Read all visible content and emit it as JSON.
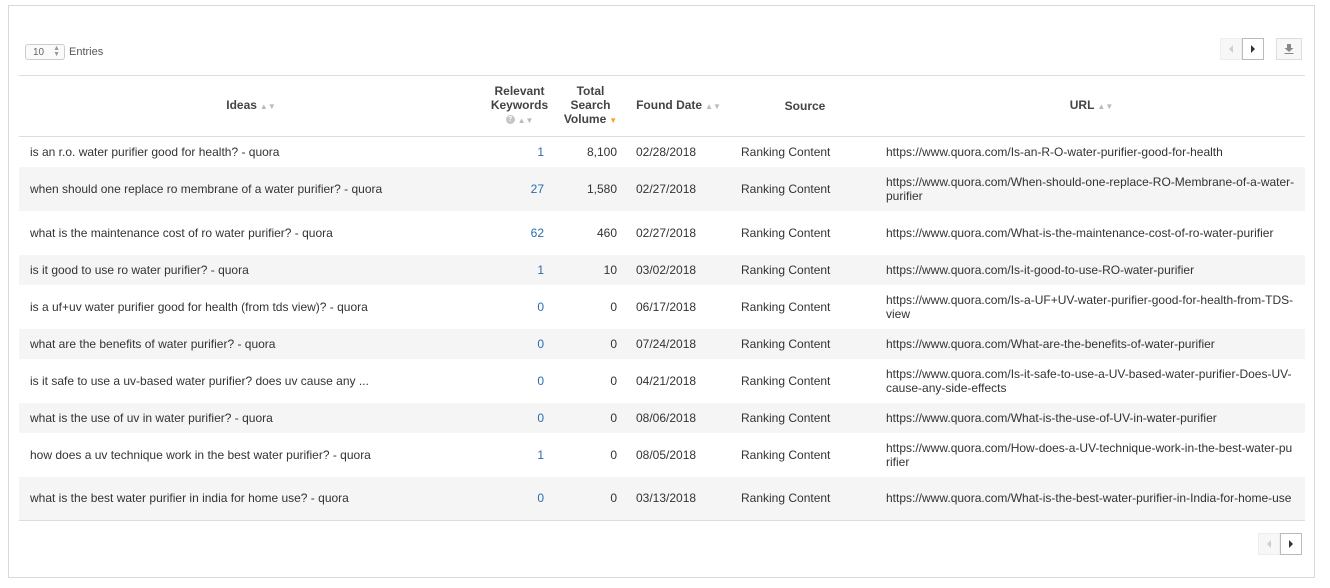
{
  "entries": {
    "value": "10",
    "label": "Entries"
  },
  "columns": {
    "ideas": "Ideas",
    "relevant_keywords": [
      "Relevant",
      "Keywords"
    ],
    "total_search_volume": [
      "Total",
      "Search",
      "Volume"
    ],
    "found_date": "Found Date",
    "source": "Source",
    "url": "URL"
  },
  "sort": {
    "active_column": "Total Search Volume",
    "direction": "descending",
    "color": "#f5a623"
  },
  "link_color": "#2a6bb2",
  "rows": [
    {
      "idea": "is an r.o. water purifier good for health? - quora",
      "keywords": "1",
      "volume": "8,100",
      "date": "02/28/2018",
      "source": "Ranking Content",
      "url": "https://www.quora.com/Is-an-R-O-water-purifier-good-for-health"
    },
    {
      "idea": "when should one replace ro membrane of a water purifier? - quora",
      "keywords": "27",
      "volume": "1,580",
      "date": "02/27/2018",
      "source": "Ranking Content",
      "url": "https://www.quora.com/When-should-one-replace-RO-Membrane-of-a-water-purifier"
    },
    {
      "idea": "what is the maintenance cost of ro water purifier? - quora",
      "keywords": "62",
      "volume": "460",
      "date": "02/27/2018",
      "source": "Ranking Content",
      "url": "https://www.quora.com/What-is-the-maintenance-cost-of-ro-water-purifier"
    },
    {
      "idea": "is it good to use ro water purifier? - quora",
      "keywords": "1",
      "volume": "10",
      "date": "03/02/2018",
      "source": "Ranking Content",
      "url": "https://www.quora.com/Is-it-good-to-use-RO-water-purifier"
    },
    {
      "idea": "is a uf+uv water purifier good for health (from tds view)? - quora",
      "keywords": "0",
      "volume": "0",
      "date": "06/17/2018",
      "source": "Ranking Content",
      "url": "https://www.quora.com/Is-a-UF+UV-water-purifier-good-for-health-from-TDS-view"
    },
    {
      "idea": "what are the benefits of water purifier? - quora",
      "keywords": "0",
      "volume": "0",
      "date": "07/24/2018",
      "source": "Ranking Content",
      "url": "https://www.quora.com/What-are-the-benefits-of-water-purifier"
    },
    {
      "idea": "is it safe to use a uv-based water purifier? does uv cause any ...",
      "keywords": "0",
      "volume": "0",
      "date": "04/21/2018",
      "source": "Ranking Content",
      "url": "https://www.quora.com/Is-it-safe-to-use-a-UV-based-water-purifier-Does-UV-cause-any-side-effects"
    },
    {
      "idea": "what is the use of uv in water purifier? - quora",
      "keywords": "0",
      "volume": "0",
      "date": "08/06/2018",
      "source": "Ranking Content",
      "url": "https://www.quora.com/What-is-the-use-of-UV-in-water-purifier"
    },
    {
      "idea": "how does a uv technique work in the best water purifier? - quora",
      "keywords": "1",
      "volume": "0",
      "date": "08/05/2018",
      "source": "Ranking Content",
      "url": "https://www.quora.com/How-does-a-UV-technique-work-in-the-best-water-purifier"
    },
    {
      "idea": "what is the best water purifier in india for home use? - quora",
      "keywords": "0",
      "volume": "0",
      "date": "03/13/2018",
      "source": "Ranking Content",
      "url": "https://www.quora.com/What-is-the-best-water-purifier-in-India-for-home-use"
    }
  ]
}
